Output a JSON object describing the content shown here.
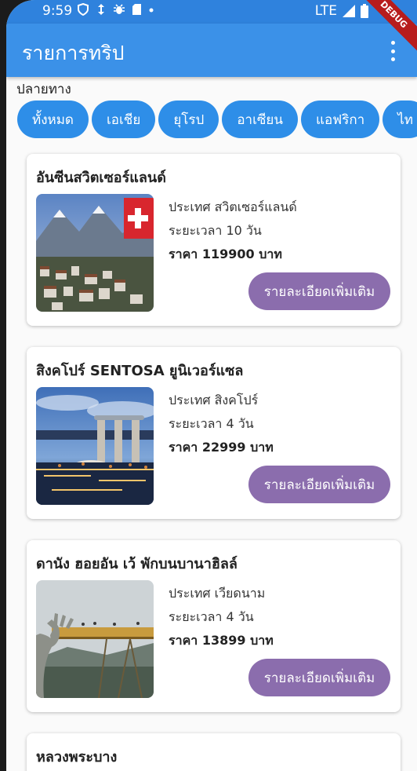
{
  "status": {
    "time": "9:59",
    "network": "LTE"
  },
  "debug_banner": "DEBUG",
  "appbar": {
    "title": "รายการทริป"
  },
  "filter": {
    "label": "ปลายทาง",
    "chips": [
      "ทั้งหมด",
      "เอเชีย",
      "ยุโรป",
      "อาเซียน",
      "แอฟริกา",
      "ไท"
    ]
  },
  "trips": [
    {
      "title": "อันซีนสวิตเซอร์แลนด์",
      "country": "ประเทศ สวิตเซอร์แลนด์",
      "duration": "ระยะเวลา 10 วัน",
      "price": "ราคา 119900 บาท",
      "button": "รายละเอียดเพิ่มเติม"
    },
    {
      "title": "สิงคโปร์ SENTOSA ยูนิเวอร์แซล",
      "country": "ประเทศ สิงคโปร์",
      "duration": "ระยะเวลา 4 วัน",
      "price": "ราคา 22999 บาท",
      "button": "รายละเอียดเพิ่มเติม"
    },
    {
      "title": "ดานัง ฮอยอัน เว้ พักบนบานาฮิลล์",
      "country": "ประเทศ เวียดนาม",
      "duration": "ระยะเวลา 4 วัน",
      "price": "ราคา 13899 บาท",
      "button": "รายละเอียดเพิ่มเติม"
    },
    {
      "title": "หลวงพระบาง"
    }
  ]
}
